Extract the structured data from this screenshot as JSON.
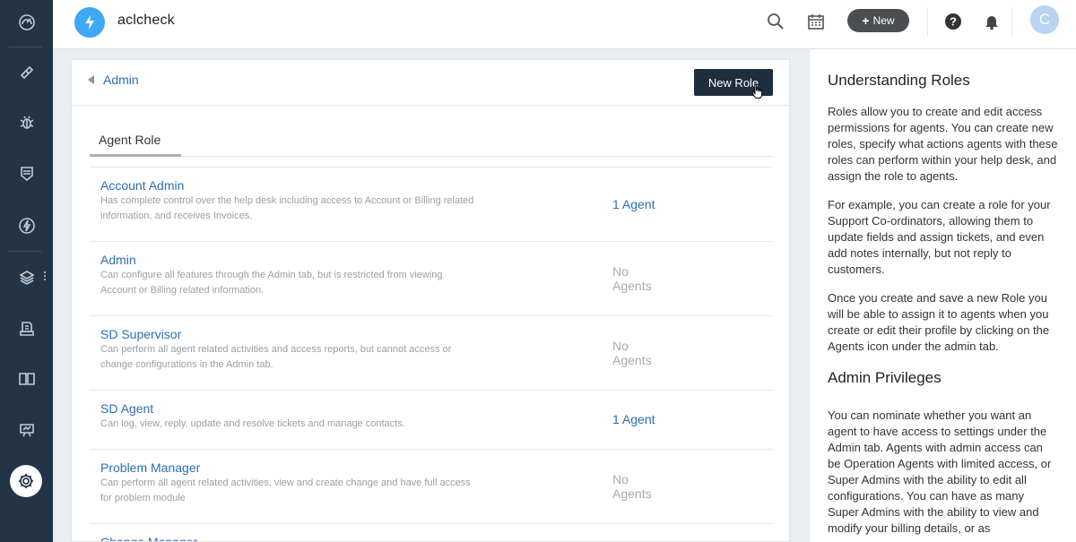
{
  "app": {
    "title": "aclcheck"
  },
  "sidebar": {
    "items": [
      {
        "name": "dashboard-icon"
      },
      {
        "name": "tickets-icon"
      },
      {
        "name": "problems-icon"
      },
      {
        "name": "changes-icon"
      },
      {
        "name": "releases-icon"
      },
      {
        "name": "assets-icon"
      },
      {
        "name": "contracts-icon"
      },
      {
        "name": "solutions-icon"
      },
      {
        "name": "reports-icon"
      },
      {
        "name": "admin-gear-icon",
        "active": true
      }
    ]
  },
  "topbar": {
    "new_label": "New",
    "avatar_initial": "C"
  },
  "main": {
    "back_label": "Admin",
    "new_role_label": "New Role",
    "tab_label": "Agent Role",
    "roles": [
      {
        "name": "Account Admin",
        "desc": "Has complete control over the help desk including access to Account or Billing related information, and receives Invoices.",
        "agents": "1 Agent",
        "has_agents": true
      },
      {
        "name": "Admin",
        "desc": "Can configure all features through the Admin tab, but is restricted from viewing Account or Billing related information.",
        "agents": "No Agents",
        "has_agents": false
      },
      {
        "name": "SD Supervisor",
        "desc": "Can perform all agent related activities and access reports, but cannot access or change configurations in the Admin tab.",
        "agents": "No Agents",
        "has_agents": false
      },
      {
        "name": "SD Agent",
        "desc": "Can log, view, reply, update and resolve tickets and manage contacts.",
        "agents": "1 Agent",
        "has_agents": true
      },
      {
        "name": "Problem Manager",
        "desc": "Can perform all agent related activities, view and create change and have full access for problem module",
        "agents": "No Agents",
        "has_agents": false
      },
      {
        "name": "Change Manager",
        "desc": "",
        "agents": "",
        "has_agents": false
      }
    ]
  },
  "help": {
    "title1": "Understanding Roles",
    "p1": "Roles allow you to create and edit access permissions for agents. You can create new roles, specify what actions agents with these roles can perform within your help desk, and assign the role to agents.",
    "p2": "For example, you can create a role for your Support Co-ordinators, allowing them to update fields and assign tickets, and even add notes internally, but not reply to customers.",
    "p3": "Once you create and save a new Role you will be able to assign it to agents when you create or edit their profile by clicking on the Agents icon under the admin tab.",
    "title2": "Admin Privileges",
    "p4": "You can nominate whether you want an agent to have access to settings under the Admin tab. Agents with admin access can be Operation Agents with limited access, or Super Admins with the ability to edit all configurations. You can have as many Super Admins with the ability to view and modify your billing details, or as"
  },
  "colors": {
    "sidebar": "#243447",
    "link": "#2c6fb1",
    "primary_button": "#1f2d3d",
    "logo": "#3fa8f4"
  }
}
